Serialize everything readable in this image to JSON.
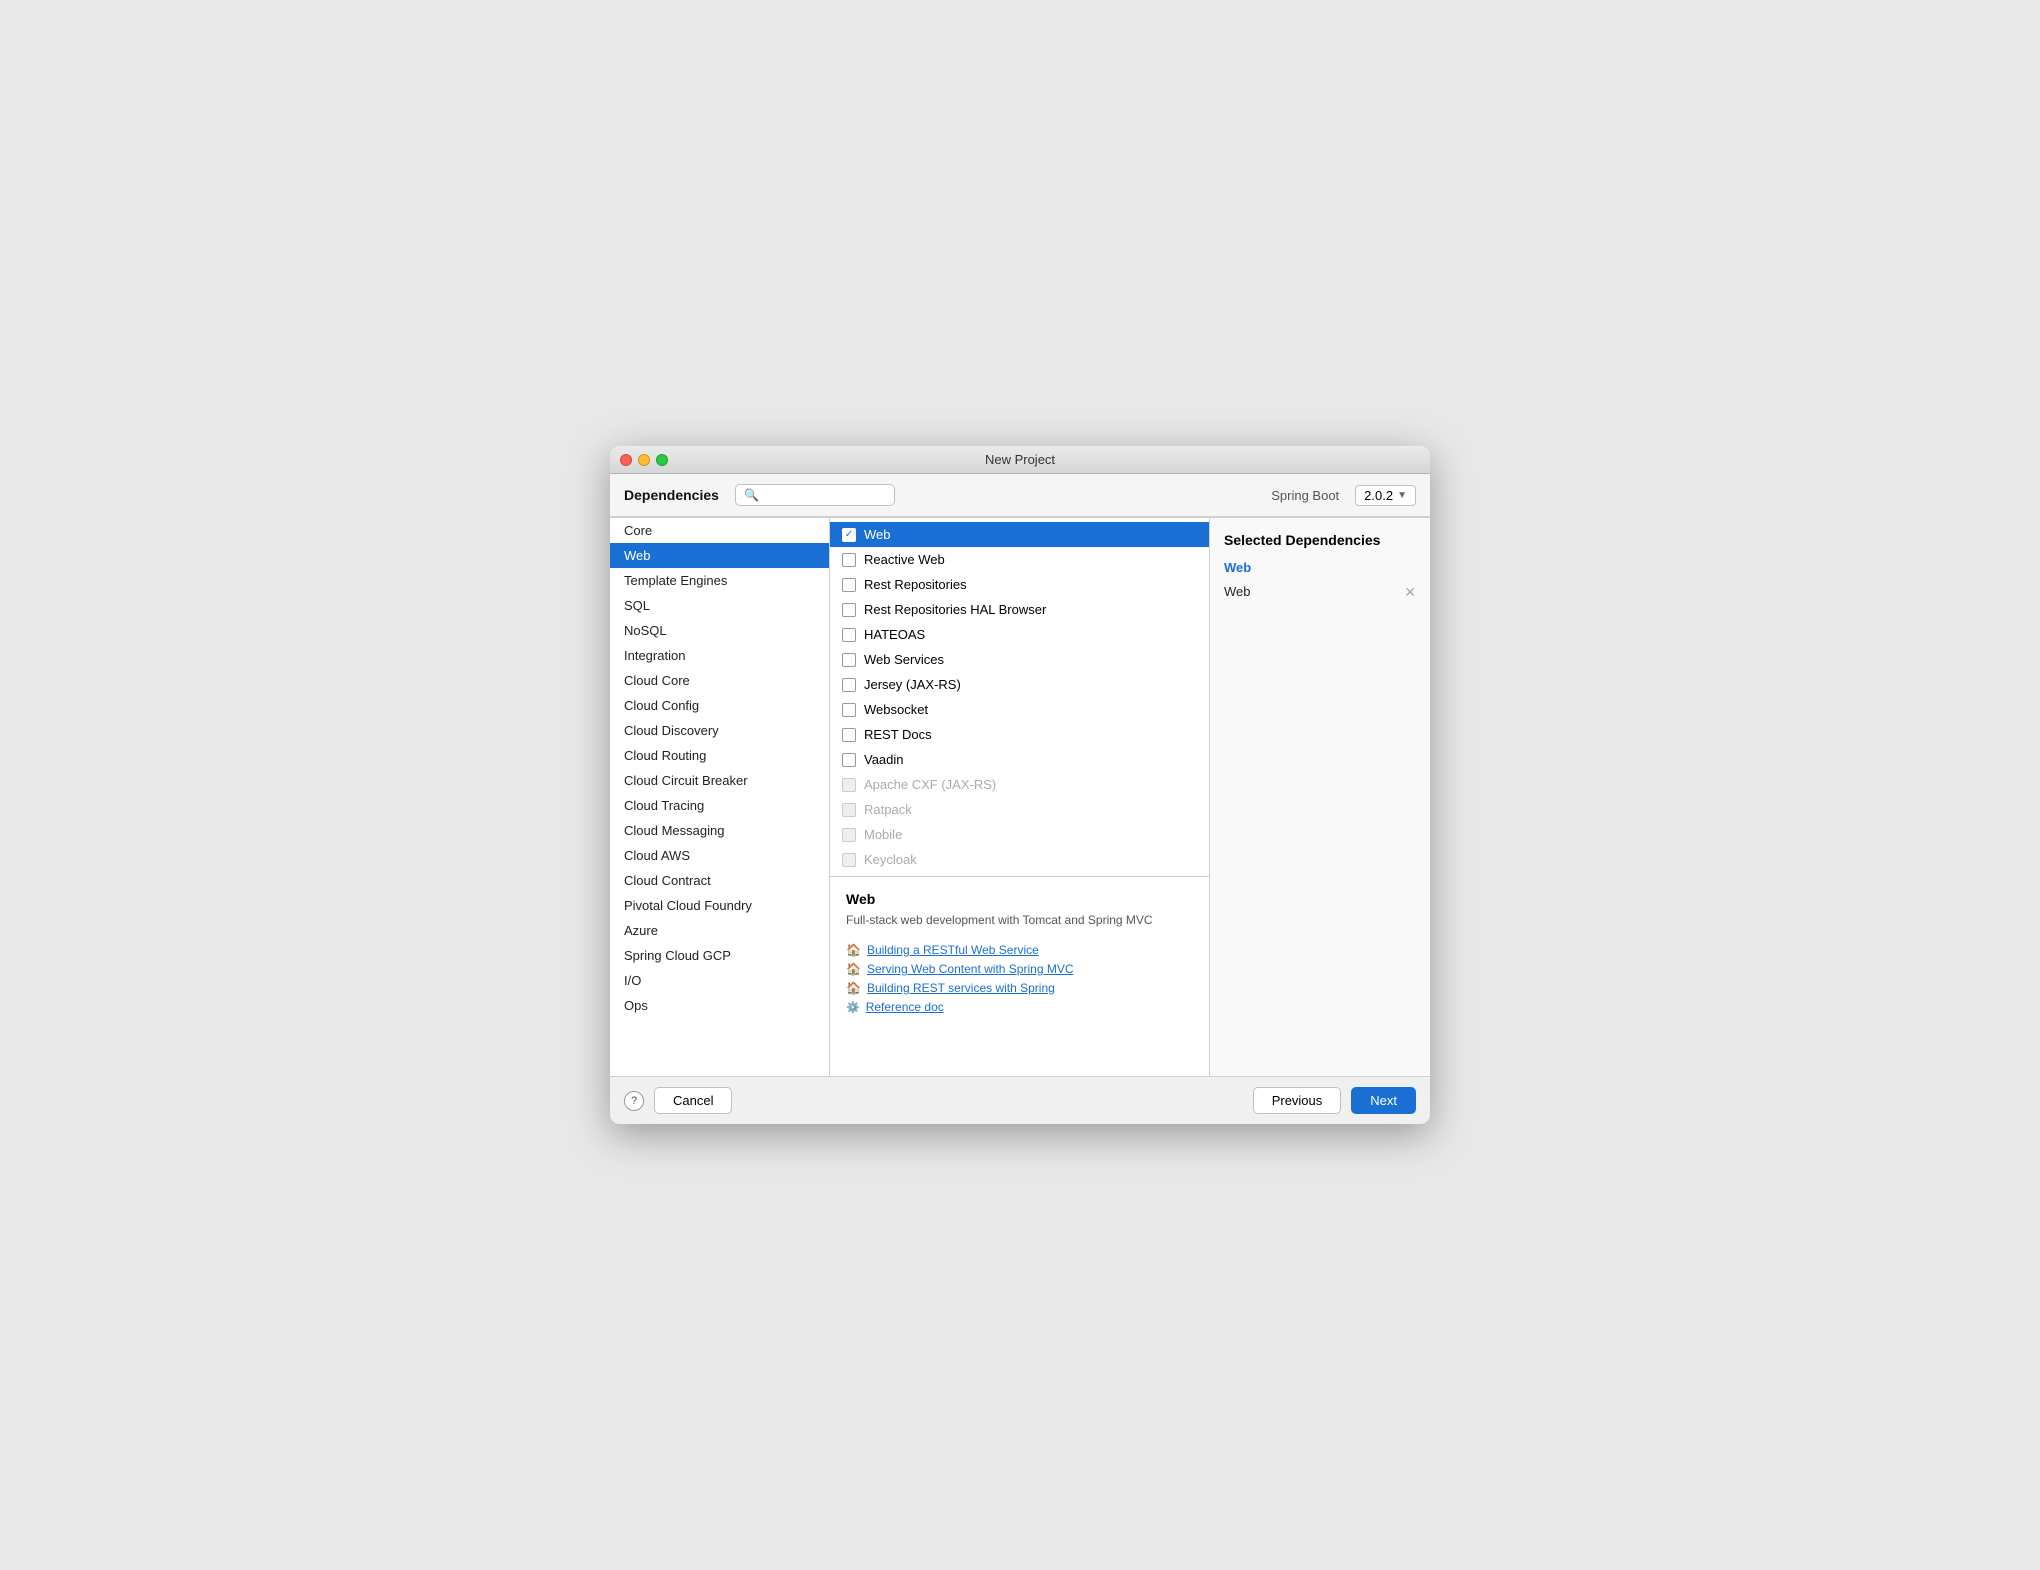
{
  "window": {
    "title": "New Project"
  },
  "header": {
    "deps_label": "Dependencies",
    "search_placeholder": "",
    "spring_boot_label": "Spring Boot",
    "spring_boot_version": "2.0.2",
    "dropdown_arrow": "▼"
  },
  "left_panel": {
    "items": [
      {
        "id": "core",
        "label": "Core",
        "active": false
      },
      {
        "id": "web",
        "label": "Web",
        "active": true
      },
      {
        "id": "template-engines",
        "label": "Template Engines",
        "active": false
      },
      {
        "id": "sql",
        "label": "SQL",
        "active": false
      },
      {
        "id": "nosql",
        "label": "NoSQL",
        "active": false
      },
      {
        "id": "integration",
        "label": "Integration",
        "active": false
      },
      {
        "id": "cloud-core",
        "label": "Cloud Core",
        "active": false
      },
      {
        "id": "cloud-config",
        "label": "Cloud Config",
        "active": false
      },
      {
        "id": "cloud-discovery",
        "label": "Cloud Discovery",
        "active": false
      },
      {
        "id": "cloud-routing",
        "label": "Cloud Routing",
        "active": false
      },
      {
        "id": "cloud-circuit-breaker",
        "label": "Cloud Circuit Breaker",
        "active": false
      },
      {
        "id": "cloud-tracing",
        "label": "Cloud Tracing",
        "active": false
      },
      {
        "id": "cloud-messaging",
        "label": "Cloud Messaging",
        "active": false
      },
      {
        "id": "cloud-aws",
        "label": "Cloud AWS",
        "active": false
      },
      {
        "id": "cloud-contract",
        "label": "Cloud Contract",
        "active": false
      },
      {
        "id": "pivotal-cloud-foundry",
        "label": "Pivotal Cloud Foundry",
        "active": false
      },
      {
        "id": "azure",
        "label": "Azure",
        "active": false
      },
      {
        "id": "spring-cloud-gcp",
        "label": "Spring Cloud GCP",
        "active": false
      },
      {
        "id": "io",
        "label": "I/O",
        "active": false
      },
      {
        "id": "ops",
        "label": "Ops",
        "active": false
      }
    ]
  },
  "middle_panel": {
    "items": [
      {
        "id": "web",
        "label": "Web",
        "checked": true,
        "selected": true,
        "disabled": false
      },
      {
        "id": "reactive-web",
        "label": "Reactive Web",
        "checked": false,
        "selected": false,
        "disabled": false
      },
      {
        "id": "rest-repositories",
        "label": "Rest Repositories",
        "checked": false,
        "selected": false,
        "disabled": false
      },
      {
        "id": "rest-repositories-hal",
        "label": "Rest Repositories HAL Browser",
        "checked": false,
        "selected": false,
        "disabled": false
      },
      {
        "id": "hateoas",
        "label": "HATEOAS",
        "checked": false,
        "selected": false,
        "disabled": false
      },
      {
        "id": "web-services",
        "label": "Web Services",
        "checked": false,
        "selected": false,
        "disabled": false
      },
      {
        "id": "jersey",
        "label": "Jersey (JAX-RS)",
        "checked": false,
        "selected": false,
        "disabled": false
      },
      {
        "id": "websocket",
        "label": "Websocket",
        "checked": false,
        "selected": false,
        "disabled": false
      },
      {
        "id": "rest-docs",
        "label": "REST Docs",
        "checked": false,
        "selected": false,
        "disabled": false
      },
      {
        "id": "vaadin",
        "label": "Vaadin",
        "checked": false,
        "selected": false,
        "disabled": false
      },
      {
        "id": "apache-cxf",
        "label": "Apache CXF (JAX-RS)",
        "checked": false,
        "selected": false,
        "disabled": true
      },
      {
        "id": "ratpack",
        "label": "Ratpack",
        "checked": false,
        "selected": false,
        "disabled": true
      },
      {
        "id": "mobile",
        "label": "Mobile",
        "checked": false,
        "selected": false,
        "disabled": true
      },
      {
        "id": "keycloak",
        "label": "Keycloak",
        "checked": false,
        "selected": false,
        "disabled": true
      }
    ]
  },
  "detail": {
    "title": "Web",
    "description": "Full-stack web development with Tomcat and Spring MVC",
    "links": [
      {
        "id": "building-restful",
        "text": "Building a RESTful Web Service",
        "type": "guide"
      },
      {
        "id": "serving-web-content",
        "text": "Serving Web Content with Spring MVC",
        "type": "guide"
      },
      {
        "id": "building-rest-services",
        "text": "Building REST services with Spring",
        "type": "guide"
      },
      {
        "id": "reference-doc",
        "text": "Reference doc",
        "type": "ref"
      }
    ]
  },
  "right_panel": {
    "title": "Selected Dependencies",
    "section_title": "Web",
    "deps": [
      {
        "id": "web-dep",
        "label": "Web"
      }
    ]
  },
  "bottom": {
    "help_label": "?",
    "cancel_label": "Cancel",
    "previous_label": "Previous",
    "next_label": "Next"
  }
}
